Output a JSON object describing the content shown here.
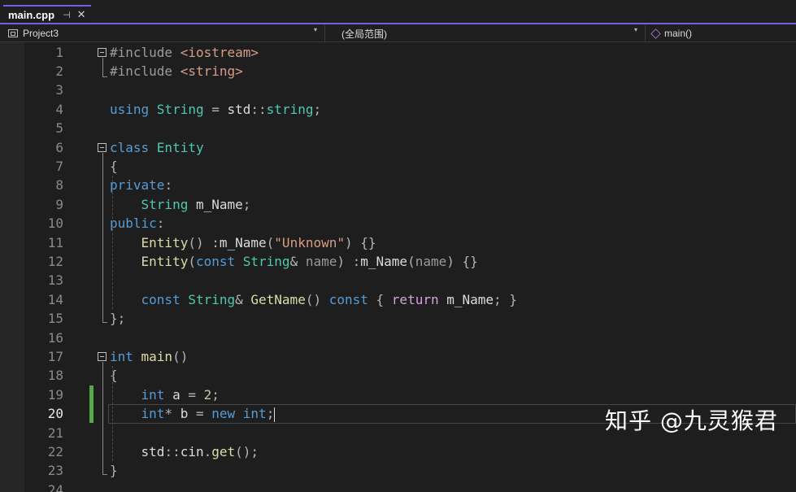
{
  "tab": {
    "title": "main.cpp",
    "pin_glyph": "⊣",
    "close_glyph": "✕"
  },
  "navbar": {
    "project": "Project3",
    "scope": "(全局范围)",
    "member": "main()",
    "dropdown_glyph": "▾"
  },
  "editor": {
    "active_line": 20,
    "line_numbers": [
      "1",
      "2",
      "3",
      "4",
      "5",
      "6",
      "7",
      "8",
      "9",
      "10",
      "11",
      "12",
      "13",
      "14",
      "15",
      "16",
      "17",
      "18",
      "19",
      "20",
      "21",
      "22",
      "23",
      "24"
    ],
    "lines": [
      [
        [
          "pp",
          "#include "
        ],
        [
          "st",
          "<iostream>"
        ]
      ],
      [
        [
          "pp",
          "#include "
        ],
        [
          "st",
          "<string>"
        ]
      ],
      [],
      [
        [
          "kw",
          "using "
        ],
        [
          "ty",
          "String"
        ],
        [
          "pu",
          " = "
        ],
        [
          "",
          "std"
        ],
        [
          "pu",
          "::"
        ],
        [
          "ty",
          "string"
        ],
        [
          "pu",
          ";"
        ]
      ],
      [],
      [
        [
          "kw",
          "class "
        ],
        [
          "ty",
          "Entity"
        ]
      ],
      [
        [
          "pu",
          "{"
        ]
      ],
      [
        [
          "kw",
          "private"
        ],
        [
          "pu",
          ":"
        ]
      ],
      [
        [
          "",
          "    "
        ],
        [
          "ty",
          "String"
        ],
        [
          "",
          " m_Name"
        ],
        [
          "pu",
          ";"
        ]
      ],
      [
        [
          "kw",
          "public"
        ],
        [
          "pu",
          ":"
        ]
      ],
      [
        [
          "",
          "    "
        ],
        [
          "fn",
          "Entity"
        ],
        [
          "pu",
          "() :"
        ],
        [
          "",
          "m_Name"
        ],
        [
          "pu",
          "("
        ],
        [
          "st",
          "\"Unknown\""
        ],
        [
          "pu",
          ") {}"
        ]
      ],
      [
        [
          "",
          "    "
        ],
        [
          "fn",
          "Entity"
        ],
        [
          "pu",
          "("
        ],
        [
          "kw",
          "const "
        ],
        [
          "ty",
          "String"
        ],
        [
          "pu",
          "& "
        ],
        [
          "pa",
          "name"
        ],
        [
          "pu",
          ") :"
        ],
        [
          "",
          "m_Name"
        ],
        [
          "pu",
          "("
        ],
        [
          "pa",
          "name"
        ],
        [
          "pu",
          ") {}"
        ]
      ],
      [],
      [
        [
          "",
          "    "
        ],
        [
          "kw",
          "const "
        ],
        [
          "ty",
          "String"
        ],
        [
          "pu",
          "& "
        ],
        [
          "fn",
          "GetName"
        ],
        [
          "pu",
          "() "
        ],
        [
          "kw",
          "const "
        ],
        [
          "pu",
          "{ "
        ],
        [
          "kw2",
          "return "
        ],
        [
          "",
          "m_Name"
        ],
        [
          "pu",
          "; }"
        ]
      ],
      [
        [
          "pu",
          "};"
        ]
      ],
      [],
      [
        [
          "kw",
          "int "
        ],
        [
          "fn",
          "main"
        ],
        [
          "pu",
          "()"
        ]
      ],
      [
        [
          "pu",
          "{"
        ]
      ],
      [
        [
          "",
          "    "
        ],
        [
          "kw",
          "int "
        ],
        [
          "",
          "a"
        ],
        [
          "pu",
          " = "
        ],
        [
          "nu",
          "2"
        ],
        [
          "pu",
          ";"
        ]
      ],
      [
        [
          "",
          "    "
        ],
        [
          "kw",
          "int"
        ],
        [
          "pu",
          "* "
        ],
        [
          "",
          "b"
        ],
        [
          "pu",
          " = "
        ],
        [
          "kw",
          "new "
        ],
        [
          "kw",
          "int"
        ],
        [
          "pu",
          ";"
        ]
      ],
      [],
      [
        [
          "",
          "    "
        ],
        [
          "",
          "std"
        ],
        [
          "pu",
          "::"
        ],
        [
          "",
          "cin"
        ],
        [
          "pu",
          "."
        ],
        [
          "fn",
          "get"
        ],
        [
          "pu",
          "();"
        ]
      ],
      [
        [
          "pu",
          "}"
        ]
      ],
      []
    ]
  },
  "watermark": {
    "text": "知乎 @九灵猴君"
  },
  "colors": {
    "accent": "#7160e8",
    "change_bar": "#57a64a",
    "keyword": "#569cd6",
    "type": "#4ec9b0",
    "function": "#dcdcaa",
    "string": "#d69d85",
    "number": "#b5cea8"
  },
  "icons": {
    "tab_pin": "pin-icon",
    "tab_close": "close-icon",
    "project": "project-icon",
    "member": "method-cube-icon",
    "dropdown": "chevron-down-icon"
  }
}
